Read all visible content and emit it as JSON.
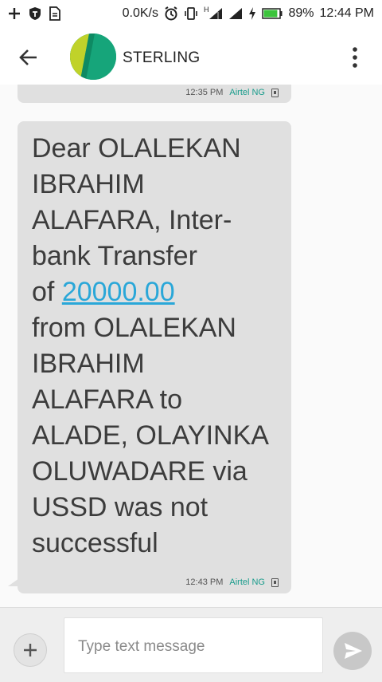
{
  "status_bar": {
    "network_speed": "0.0K/s",
    "network_type": "H",
    "battery_percent": "89%",
    "time": "12:44 PM",
    "battery_level": 0.89
  },
  "app_bar": {
    "contact_name": "STERLING"
  },
  "messages": [
    {
      "time": "12:35 PM",
      "carrier": "Airtel NG"
    },
    {
      "text_before": "Dear OLALEKAN\nIBRAHIM\nALAFARA, Inter-\nbank Transfer\nof ",
      "amount": "20000.00",
      "text_after": "\nfrom OLALEKAN\nIBRAHIM\nALAFARA to\nALADE, OLAYINKA\nOLUWADARE via\nUSSD was not\nsuccessful",
      "time": "12:43 PM",
      "carrier": "Airtel NG"
    }
  ],
  "composer": {
    "placeholder": "Type text message"
  },
  "colors": {
    "bubble": "#e0e0e0",
    "link": "#2aa7d8",
    "carrier": "#1a9c8c",
    "avatar_green": "#16a57a",
    "avatar_lime": "#c0d22a",
    "battery": "#3cc43c"
  }
}
